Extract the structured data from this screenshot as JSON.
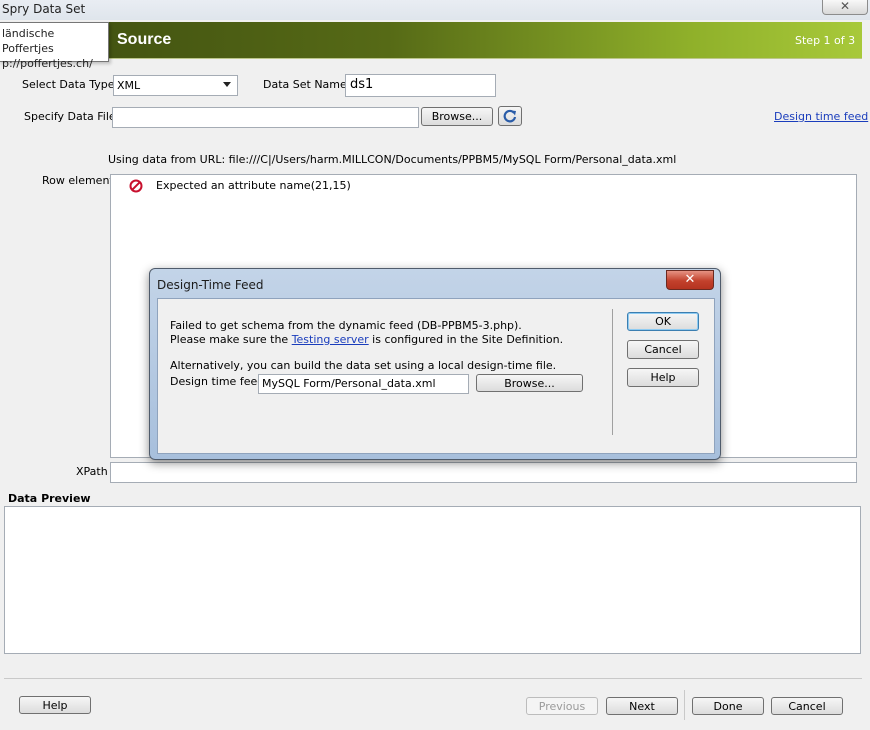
{
  "window": {
    "title": "Spry Data Set",
    "close_glyph": "✕"
  },
  "tooltip": {
    "line1": "ländische Poffertjes",
    "line2": "p://poffertjes.ch/"
  },
  "banner": {
    "title": "Source",
    "step": "Step 1 of 3"
  },
  "form": {
    "data_type_label": "Select Data Type",
    "data_type_value": "XML",
    "dataset_name_label": "Data Set Name",
    "dataset_name_value": "ds1",
    "data_file_label": "Specify Data File",
    "data_file_value": "",
    "browse_label": "Browse...",
    "design_time_feed_link": "Design time feed",
    "using_data_text": "Using data from URL: file:///C|/Users/harm.MILLCON/Documents/PPBM5/MySQL Form/Personal_data.xml",
    "row_element_label": "Row element",
    "row_error": "Expected an attribute name(21,15)",
    "xpath_label": "XPath",
    "xpath_value": "",
    "preview_label": "Data Preview"
  },
  "footer": {
    "help": "Help",
    "previous": "Previous",
    "next": "Next",
    "done": "Done",
    "cancel": "Cancel"
  },
  "dialog": {
    "title": "Design-Time Feed",
    "close_glyph": "✕",
    "msg1": "Failed to get schema from the dynamic feed (DB-PPBM5-3.php).",
    "msg2_pre": "Please make sure the ",
    "msg2_link": "Testing server",
    "msg2_post": " is configured in the Site Definition.",
    "msg3": "Alternatively, you can build the data set using a local design-time file.",
    "feed_label": "Design time feed:",
    "feed_value": "MySQL Form/Personal_data.xml",
    "browse": "Browse...",
    "ok": "OK",
    "cancel": "Cancel",
    "help": "Help"
  },
  "colors": {
    "banner_dark": "#3d4c10",
    "banner_light": "#a8c93a",
    "link": "#1a3dbc",
    "error": "#c8102e"
  },
  "icons": {
    "error": "no-entry-icon",
    "refresh": "refresh-icon",
    "dropdown": "chevron-down-icon"
  }
}
